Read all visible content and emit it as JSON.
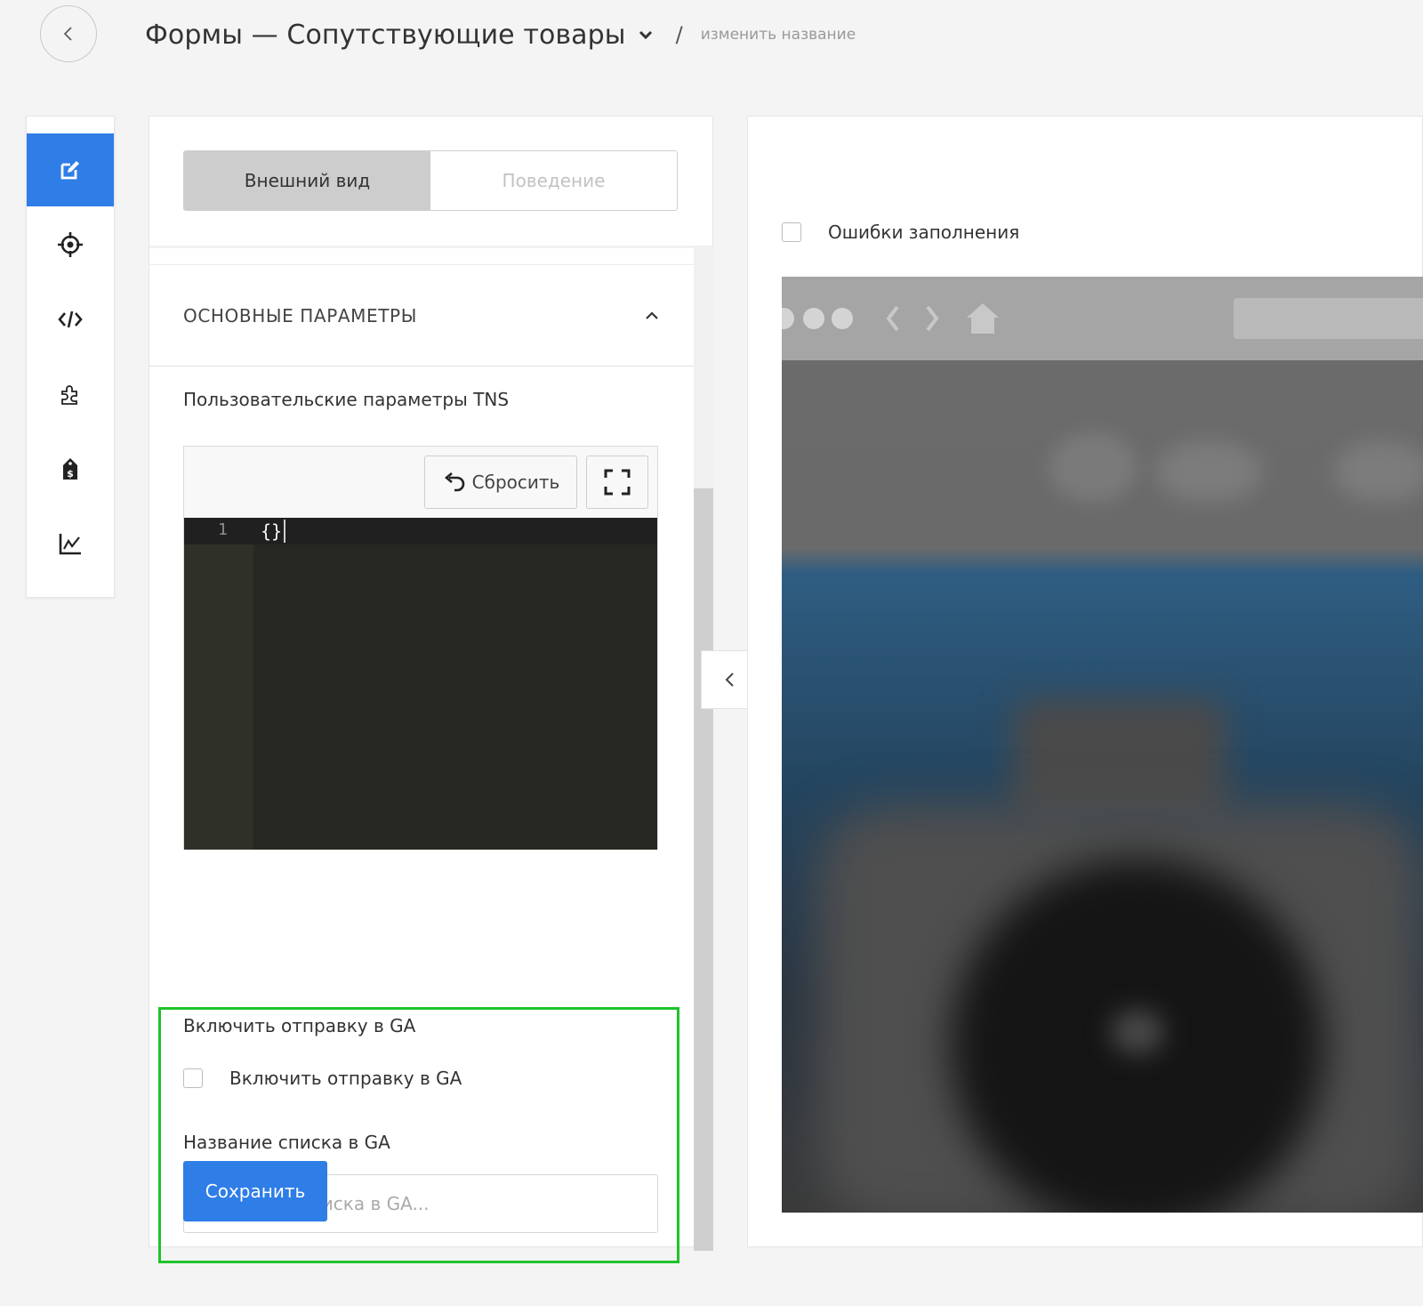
{
  "header": {
    "title": "Формы — Сопутствующие товары",
    "separator": "/",
    "rename_link": "изменить название"
  },
  "sidebar": {
    "items": [
      {
        "icon": "edit-icon",
        "active": true
      },
      {
        "icon": "target-icon",
        "active": false
      },
      {
        "icon": "code-icon",
        "active": false
      },
      {
        "icon": "puzzle-icon",
        "active": false
      },
      {
        "icon": "price-tag-icon",
        "active": false
      },
      {
        "icon": "chart-icon",
        "active": false
      }
    ]
  },
  "panel": {
    "tabs": [
      {
        "label": "Внешний вид",
        "active": true
      },
      {
        "label": "Поведение",
        "active": false
      }
    ],
    "section_title": "ОСНОВНЫЕ ПАРАМЕТРЫ",
    "tns_label": "Пользовательские параметры TNS",
    "reset_label": "Сбросить",
    "editor": {
      "line_number": "1",
      "code": "{}"
    },
    "ga_section_label": "Включить отправку в GA",
    "ga_checkbox_label": "Включить отправку в GA",
    "ga_checkbox_checked": false,
    "ga_list_label": "Название списка в GA",
    "ga_list_placeholder": "Название списка в GA...",
    "ga_list_value": "",
    "save_label": "Сохранить"
  },
  "preview": {
    "errors_label": "Ошибки заполнения",
    "errors_checked": false
  },
  "colors": {
    "accent": "#2f7de7",
    "highlight_border": "#1ec42a",
    "editor_bg": "#272822"
  }
}
